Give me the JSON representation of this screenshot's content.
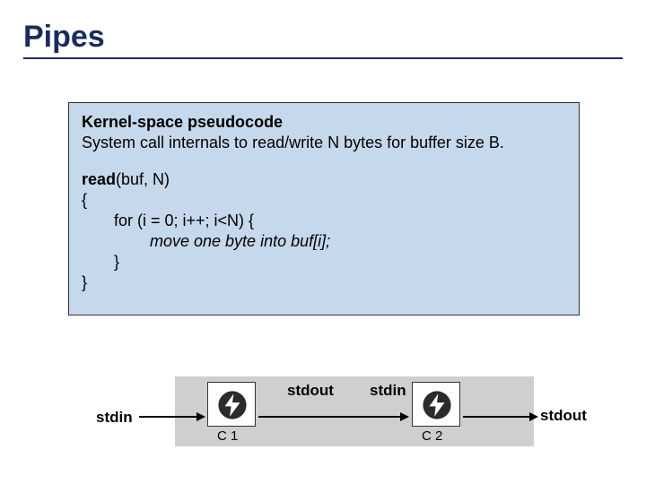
{
  "title": "Pipes",
  "codebox": {
    "header_bold": "Kernel-space pseudocode",
    "header_sub": "System call internals to read/write N bytes for buffer size B.",
    "fn_sig_bold": "read",
    "fn_sig_rest": "(buf, N)",
    "brace_open": "{",
    "for_line": "for (i = 0; i++; i<N) {",
    "move_line": "move one byte into buf[i];",
    "inner_brace_close": "}",
    "brace_close": "}"
  },
  "diagram": {
    "c1_label": "C 1",
    "c2_label": "C 2",
    "stdin_left": "stdin",
    "stdout_mid": "stdout",
    "stdin_mid": "stdin",
    "stdout_right": "stdout"
  }
}
